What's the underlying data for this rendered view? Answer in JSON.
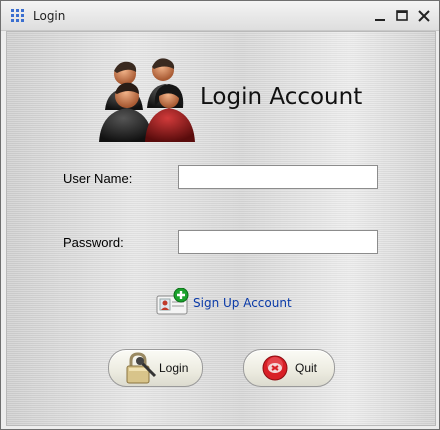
{
  "window": {
    "title": "Login"
  },
  "icons": {
    "app": "grid-app-icon",
    "minimize": "minimize-icon",
    "maximize": "maximize-icon",
    "close": "close-icon",
    "header": "user-group-icon",
    "signup": "add-user-card-icon",
    "login": "padlock-key-icon",
    "quit": "red-x-circle-icon"
  },
  "header": {
    "title": "Login Account"
  },
  "form": {
    "username_label": "User Name:",
    "username_value": "",
    "password_label": "Password:",
    "password_value": ""
  },
  "signup": {
    "label": "Sign Up Account"
  },
  "buttons": {
    "login_label": "Login",
    "quit_label": "Quit"
  },
  "colors": {
    "link": "#0a3aa8",
    "app_icon": "#3b6fd0",
    "quit_icon": "#d81f26"
  }
}
